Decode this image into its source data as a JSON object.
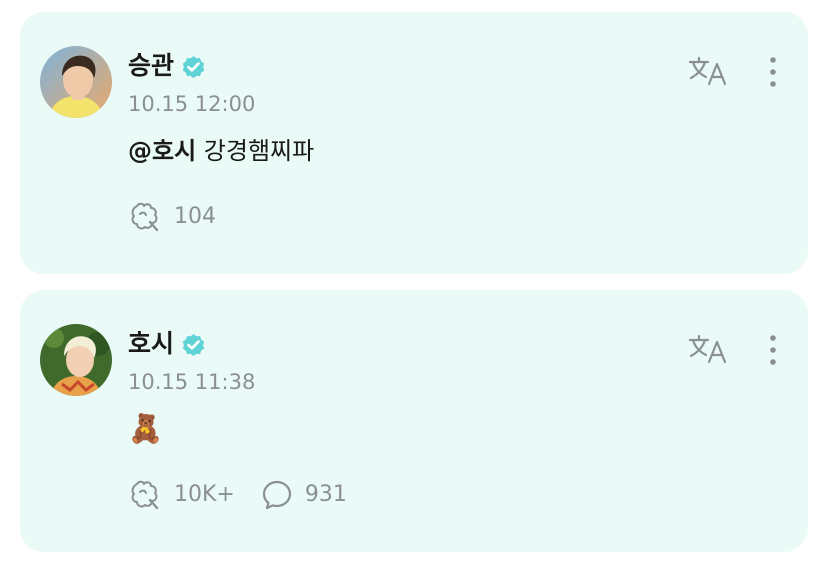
{
  "colors": {
    "card_bg": "#eafaf7",
    "verified": "#5fd3d6",
    "muted": "#8a8f95",
    "text": "#1a1a1a"
  },
  "posts": [
    {
      "author": "승관",
      "verified_icon": "verified-badge-icon",
      "time": "10.15 12:00",
      "mention": "@호시",
      "text": " 강경햄찌파",
      "reaction_count": "104",
      "comment_count": null
    },
    {
      "author": "호시",
      "verified_icon": "verified-badge-icon",
      "time": "10.15 11:38",
      "mention": "",
      "text": "🧸",
      "reaction_count": "10K+",
      "comment_count": "931"
    }
  ]
}
